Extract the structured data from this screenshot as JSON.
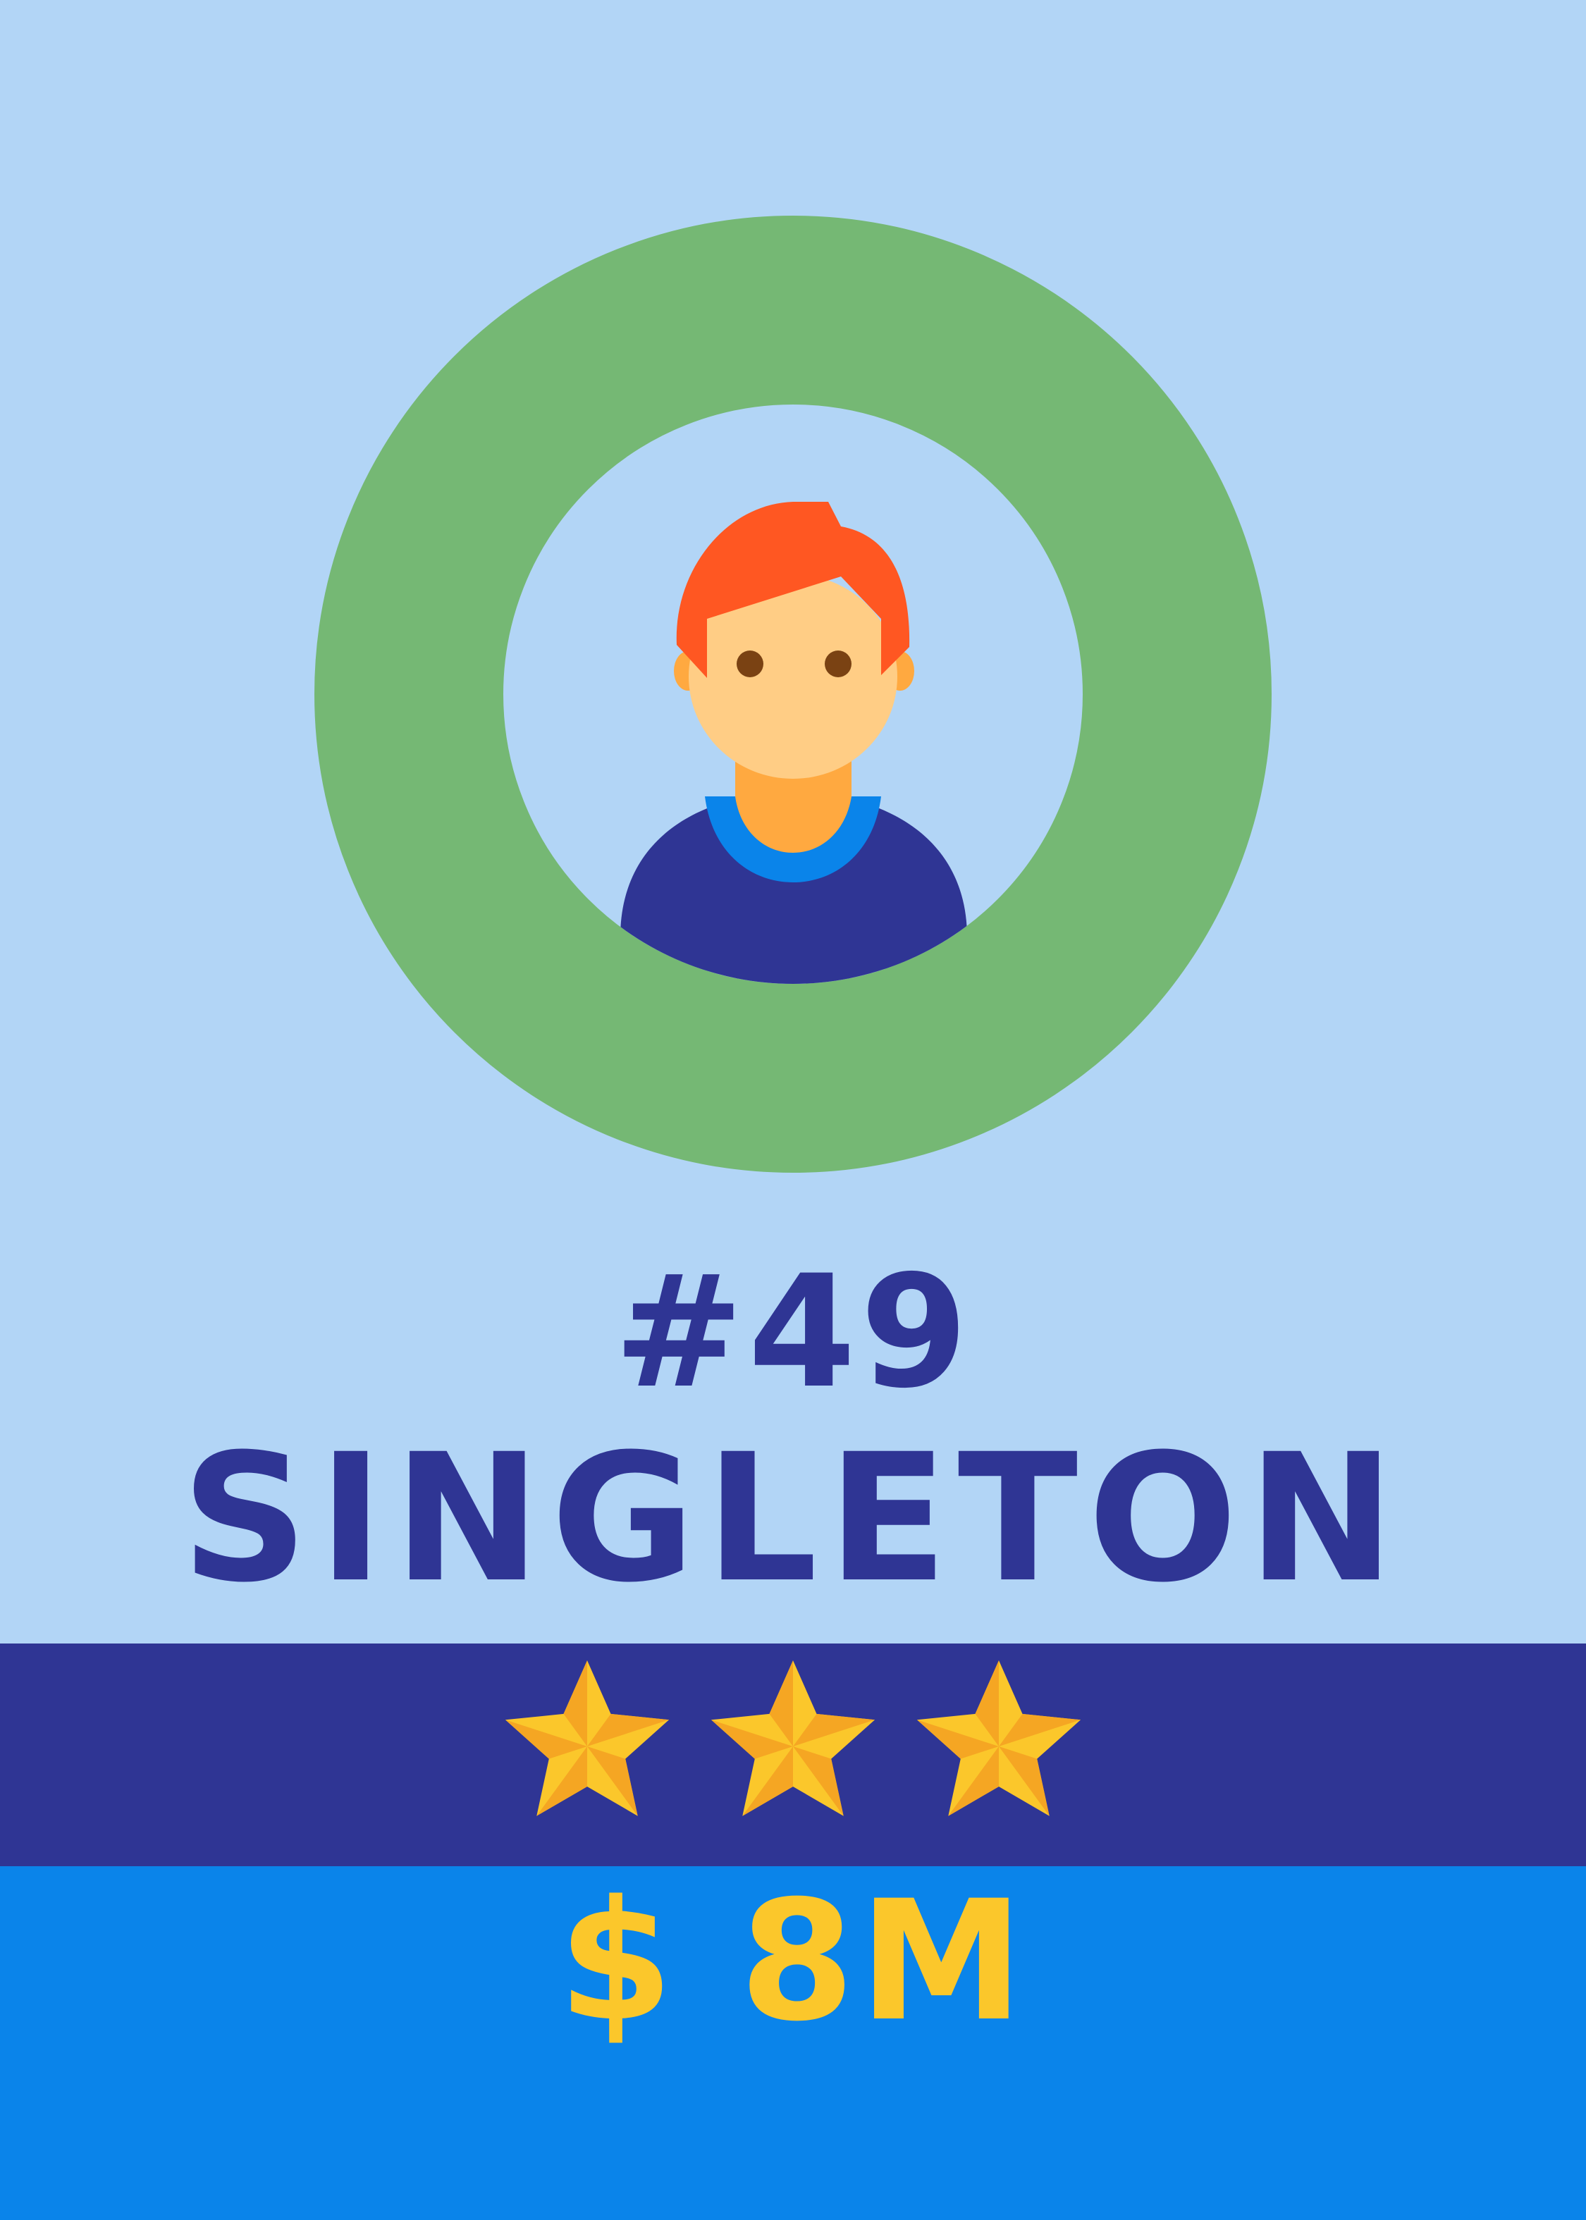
{
  "card": {
    "rank": "#49",
    "name": "SINGLETON",
    "value": "$ 8M",
    "rating": {
      "stars": 3
    }
  },
  "icons": {
    "avatar": "male-player-avatar-icon",
    "star": "star-icon"
  },
  "colors": {
    "background": "#b2d5f6",
    "ring": "#75b874",
    "navy": "#2f3594",
    "blue": "#0a84ea",
    "gold": "#fbc72b",
    "hair": "#ff5722",
    "skin": "#ffcd85",
    "neck": "#ffa940"
  }
}
